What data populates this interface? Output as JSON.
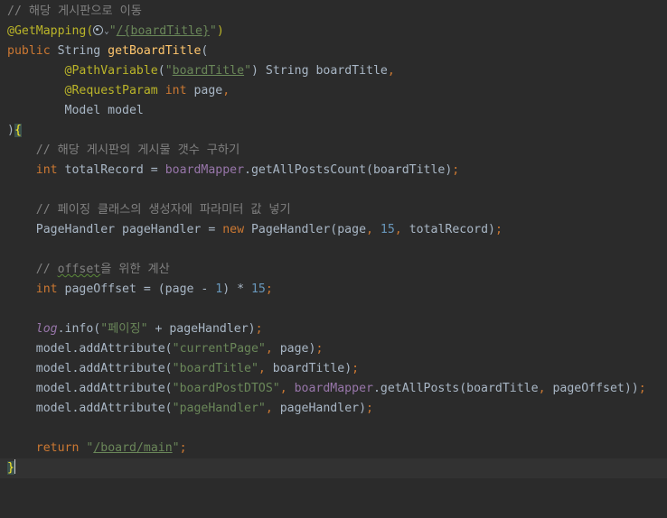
{
  "code": {
    "line1_comment": "// 해당 게시판으로 이동",
    "line2": {
      "annotation": "@GetMapping(",
      "string_open": "\"",
      "path": "/{boardTitle}",
      "string_close": "\"",
      "close": ")"
    },
    "line3": {
      "kw_public": "public",
      "type": " String ",
      "method": "getBoardTitle",
      "paren": "("
    },
    "line4": {
      "indent": "        ",
      "annotation": "@PathVariable",
      "open": "(",
      "string_open": "\"",
      "var": "boardTitle",
      "string_close": "\"",
      "rest": ") String boardTitle",
      "comma": ","
    },
    "line5": {
      "indent": "        ",
      "annotation": "@RequestParam ",
      "kw_int": "int",
      "rest": " page",
      "comma": ","
    },
    "line6": {
      "indent": "        ",
      "rest": "Model model"
    },
    "line7": {
      "paren": ")",
      "brace": "{"
    },
    "line8": {
      "indent": "    ",
      "comment": "// 해당 게시판의 게시물 갯수 구하기"
    },
    "line9": {
      "indent": "    ",
      "kw_int": "int",
      "a": " totalRecord = ",
      "field": "boardMapper",
      "b": ".getAllPostsCount(boardTitle)",
      "semi": ";"
    },
    "line10": {
      "indent": "    ",
      "comment": "// 페이징 클래스의 생성자에 파라미터 값 넣기"
    },
    "line11": {
      "indent": "    ",
      "a": "PageHandler pageHandler = ",
      "kw_new": "new",
      "b": " PageHandler(page",
      "c1": ", ",
      "num": "15",
      "c2": ", ",
      "c": "totalRecord)",
      "semi": ";"
    },
    "line12": {
      "indent": "    ",
      "c1": "// ",
      "squiggle": "offset",
      "c2": "을 위한 계산"
    },
    "line13": {
      "indent": "    ",
      "kw_int": "int",
      "a": " pageOffset = (page - ",
      "num1": "1",
      "b": ") * ",
      "num2": "15",
      "semi": ";"
    },
    "line14": {
      "indent": "    ",
      "static": "log",
      "a": ".info(",
      "str": "\"페이징\"",
      "b": " + pageHandler)",
      "semi": ";"
    },
    "line15": {
      "indent": "    ",
      "a": "model.addAttribute(",
      "str": "\"currentPage\"",
      "c": ", ",
      "b": "page)",
      "semi": ";"
    },
    "line16": {
      "indent": "    ",
      "a": "model.addAttribute(",
      "str": "\"boardTitle\"",
      "c": ", ",
      "b": "boardTitle)",
      "semi": ";"
    },
    "line17": {
      "indent": "    ",
      "a": "model.addAttribute(",
      "str": "\"boardPostDTOS\"",
      "c": ", ",
      "field": "boardMapper",
      "b": ".getAllPosts(boardTitle",
      "c2": ", ",
      "d": "pageOffset))",
      "semi": ";"
    },
    "line18": {
      "indent": "    ",
      "a": "model.addAttribute(",
      "str": "\"pageHandler\"",
      "c": ", ",
      "b": "pageHandler)",
      "semi": ";"
    },
    "line19": {
      "indent": "    ",
      "kw_return": "return",
      "sp": " ",
      "q1": "\"",
      "path": "/board/main",
      "q2": "\"",
      "semi": ";"
    },
    "line20": {
      "brace": "}"
    }
  }
}
